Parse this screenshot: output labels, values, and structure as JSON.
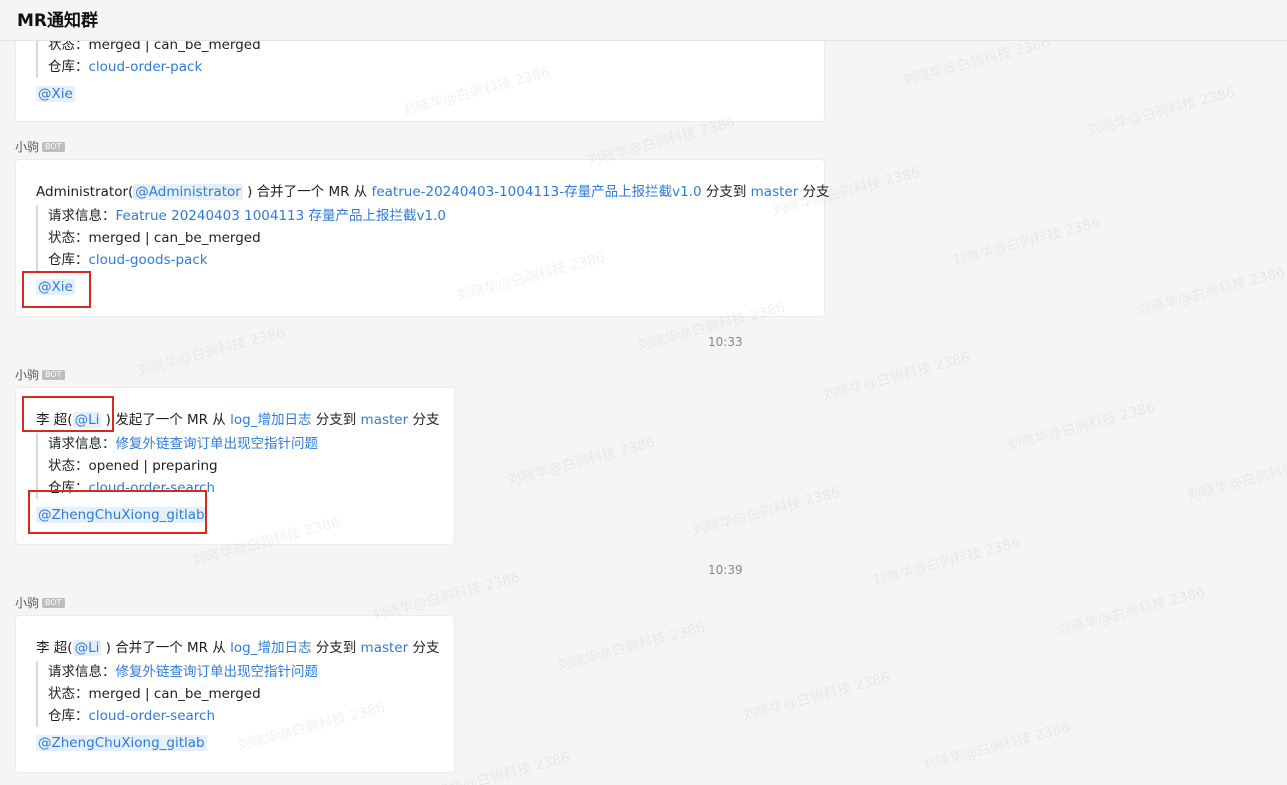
{
  "header": {
    "title": "MR通知群"
  },
  "bot_badge": "BOT",
  "watermark": "刘晓华@白驹科技 2386",
  "labels": {
    "request": "请求信息：",
    "status": "状态：",
    "repo": "仓库："
  },
  "messages": [
    {
      "status": "merged | can_be_merged",
      "repo": "cloud-order-pack",
      "mention": "@Xie"
    },
    {
      "sender": "小驹",
      "head": {
        "name": "Administrator(",
        "user": "@Administrator",
        "action": " ) 合并了一个 MR 从 ",
        "source_branch": "featrue-20240403-1004113-存量产品上报拦截v1.0",
        "to_text": " 分支到 ",
        "target_branch": "master",
        "tail": " 分支"
      },
      "request": "Featrue 20240403 1004113 存量产品上报拦截v1.0",
      "status": "merged | can_be_merged",
      "repo": "cloud-goods-pack",
      "mention": "@Xie"
    },
    {
      "time": "10:33",
      "sender": "小驹",
      "head": {
        "name": "李 超(",
        "user": "@Li",
        "action": " ) 发起了一个 MR 从 ",
        "source_branch": "log_增加日志",
        "to_text": " 分支到 ",
        "target_branch": "master",
        "tail": " 分支"
      },
      "request": "修复外链查询订单出现空指针问题",
      "status": "opened | preparing",
      "repo": "cloud-order-search",
      "mention": "@ZhengChuXiong_gitlab"
    },
    {
      "time": "10:39",
      "sender": "小驹",
      "head": {
        "name": "李 超(",
        "user": "@Li",
        "action": " ) 合并了一个 MR 从 ",
        "source_branch": "log_增加日志",
        "to_text": " 分支到 ",
        "target_branch": "master",
        "tail": " 分支"
      },
      "request": "修复外链查询订单出现空指针问题",
      "status": "merged | can_be_merged",
      "repo": "cloud-order-search",
      "mention": "@ZhengChuXiong_gitlab"
    }
  ]
}
